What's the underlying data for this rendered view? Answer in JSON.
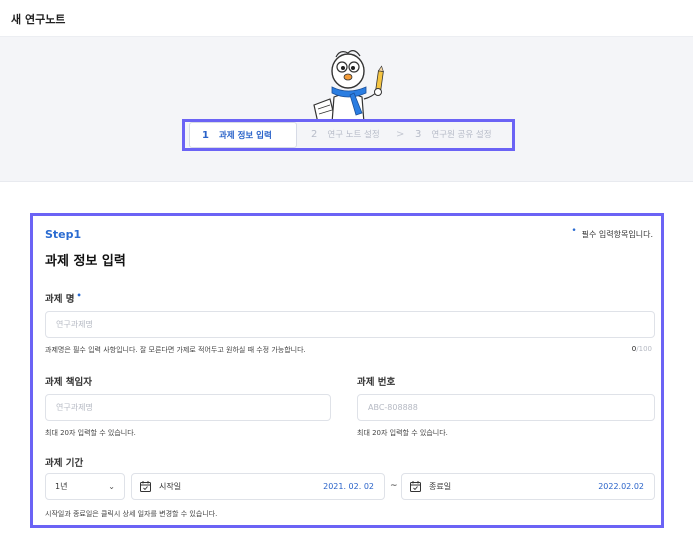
{
  "header": {
    "title": "새 연구노트"
  },
  "stepper": {
    "steps": [
      {
        "num": "1",
        "label": "과제 정보 입력"
      },
      {
        "num": "2",
        "label": "연구 노트 설정"
      },
      {
        "num": "3",
        "label": "연구원 공유 설정"
      }
    ],
    "separator": ">",
    "active_index": 1
  },
  "form": {
    "step_label": "Step1",
    "required_note": "필수 입력항목입니다.",
    "required_mark": "•",
    "title": "과제 정보 입력",
    "project_name": {
      "label": "과제 명",
      "required_mark": "•",
      "placeholder": "연구과제명",
      "value": "",
      "hint": "과제명은 필수 입력 사항입니다. 잘 모른다면 가제로 적어두고 원하실 때 수정 가능합니다.",
      "count": "0",
      "max": "/100"
    },
    "project_lead": {
      "label": "과제 책임자",
      "placeholder": "연구과제명",
      "value": "",
      "hint": "최대 20자 입력할 수 있습니다."
    },
    "project_number": {
      "label": "과제 번호",
      "placeholder": "ABC-808888",
      "value": "",
      "hint": "최대 20자 입력할 수 있습니다."
    },
    "project_period": {
      "label": "과제 기간",
      "duration": "1년",
      "start_label": "시작일",
      "start_value": "2021. 02. 02",
      "separator": "~",
      "end_label": "종료일",
      "end_value": "2022.02.02",
      "hint": "시작일과 종료일은 클릭시 상세 일자를 변경할 수 있습니다."
    }
  },
  "colors": {
    "accent": "#2a6bd1",
    "highlight_border": "#6b63f5"
  },
  "icons": {
    "calendar": "calendar-icon",
    "chevron": "chevron-down-icon",
    "mascot": "mascot-illustration"
  }
}
